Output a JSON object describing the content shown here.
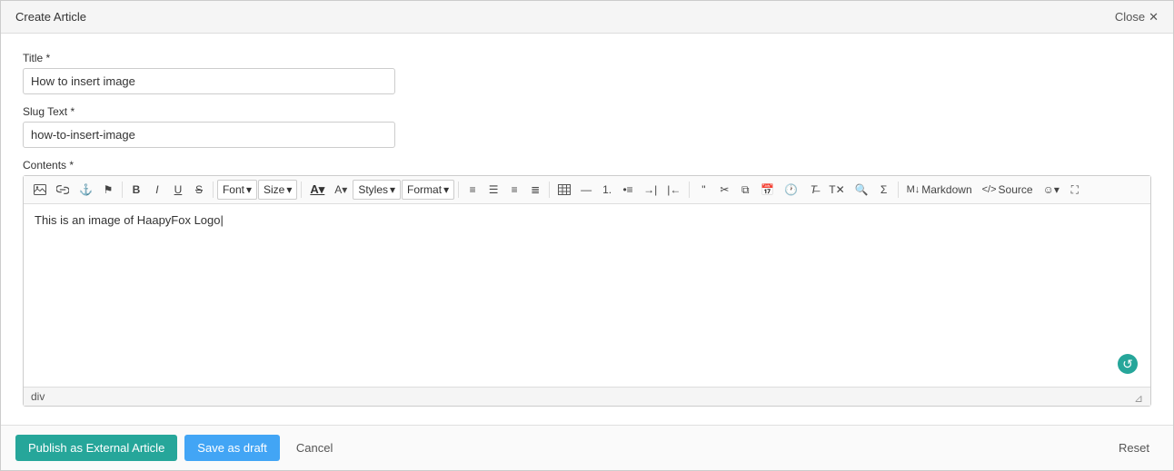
{
  "header": {
    "title": "Create Article",
    "close_label": "Close"
  },
  "form": {
    "title_label": "Title *",
    "title_value": "How to insert image",
    "slug_label": "Slug Text *",
    "slug_value": "how-to-insert-image",
    "contents_label": "Contents *"
  },
  "toolbar": {
    "font_label": "Font",
    "size_label": "Size",
    "styles_label": "Styles",
    "format_label": "Format",
    "markdown_label": "Markdown",
    "source_label": "Source"
  },
  "editor": {
    "content": "This is an image of HaapyFox Logo",
    "footer_tag": "div"
  },
  "footer": {
    "publish_label": "Publish as External Article",
    "draft_label": "Save as draft",
    "cancel_label": "Cancel",
    "reset_label": "Reset"
  }
}
